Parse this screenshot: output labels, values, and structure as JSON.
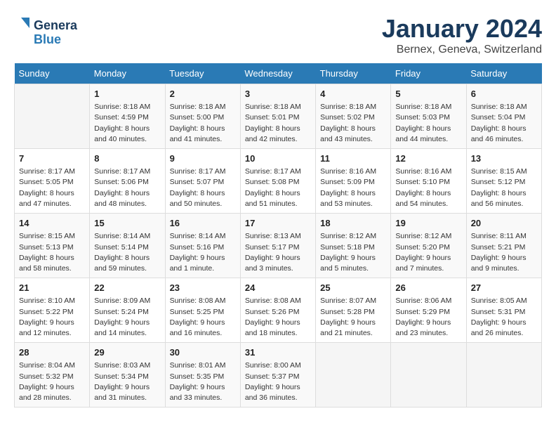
{
  "logo": {
    "line1": "General",
    "line2": "Blue"
  },
  "title": "January 2024",
  "subtitle": "Bernex, Geneva, Switzerland",
  "days_header": [
    "Sunday",
    "Monday",
    "Tuesday",
    "Wednesday",
    "Thursday",
    "Friday",
    "Saturday"
  ],
  "weeks": [
    [
      {
        "day": "",
        "info": ""
      },
      {
        "day": "1",
        "info": "Sunrise: 8:18 AM\nSunset: 4:59 PM\nDaylight: 8 hours\nand 40 minutes."
      },
      {
        "day": "2",
        "info": "Sunrise: 8:18 AM\nSunset: 5:00 PM\nDaylight: 8 hours\nand 41 minutes."
      },
      {
        "day": "3",
        "info": "Sunrise: 8:18 AM\nSunset: 5:01 PM\nDaylight: 8 hours\nand 42 minutes."
      },
      {
        "day": "4",
        "info": "Sunrise: 8:18 AM\nSunset: 5:02 PM\nDaylight: 8 hours\nand 43 minutes."
      },
      {
        "day": "5",
        "info": "Sunrise: 8:18 AM\nSunset: 5:03 PM\nDaylight: 8 hours\nand 44 minutes."
      },
      {
        "day": "6",
        "info": "Sunrise: 8:18 AM\nSunset: 5:04 PM\nDaylight: 8 hours\nand 46 minutes."
      }
    ],
    [
      {
        "day": "7",
        "info": "Sunrise: 8:17 AM\nSunset: 5:05 PM\nDaylight: 8 hours\nand 47 minutes."
      },
      {
        "day": "8",
        "info": "Sunrise: 8:17 AM\nSunset: 5:06 PM\nDaylight: 8 hours\nand 48 minutes."
      },
      {
        "day": "9",
        "info": "Sunrise: 8:17 AM\nSunset: 5:07 PM\nDaylight: 8 hours\nand 50 minutes."
      },
      {
        "day": "10",
        "info": "Sunrise: 8:17 AM\nSunset: 5:08 PM\nDaylight: 8 hours\nand 51 minutes."
      },
      {
        "day": "11",
        "info": "Sunrise: 8:16 AM\nSunset: 5:09 PM\nDaylight: 8 hours\nand 53 minutes."
      },
      {
        "day": "12",
        "info": "Sunrise: 8:16 AM\nSunset: 5:10 PM\nDaylight: 8 hours\nand 54 minutes."
      },
      {
        "day": "13",
        "info": "Sunrise: 8:15 AM\nSunset: 5:12 PM\nDaylight: 8 hours\nand 56 minutes."
      }
    ],
    [
      {
        "day": "14",
        "info": "Sunrise: 8:15 AM\nSunset: 5:13 PM\nDaylight: 8 hours\nand 58 minutes."
      },
      {
        "day": "15",
        "info": "Sunrise: 8:14 AM\nSunset: 5:14 PM\nDaylight: 8 hours\nand 59 minutes."
      },
      {
        "day": "16",
        "info": "Sunrise: 8:14 AM\nSunset: 5:16 PM\nDaylight: 9 hours\nand 1 minute."
      },
      {
        "day": "17",
        "info": "Sunrise: 8:13 AM\nSunset: 5:17 PM\nDaylight: 9 hours\nand 3 minutes."
      },
      {
        "day": "18",
        "info": "Sunrise: 8:12 AM\nSunset: 5:18 PM\nDaylight: 9 hours\nand 5 minutes."
      },
      {
        "day": "19",
        "info": "Sunrise: 8:12 AM\nSunset: 5:20 PM\nDaylight: 9 hours\nand 7 minutes."
      },
      {
        "day": "20",
        "info": "Sunrise: 8:11 AM\nSunset: 5:21 PM\nDaylight: 9 hours\nand 9 minutes."
      }
    ],
    [
      {
        "day": "21",
        "info": "Sunrise: 8:10 AM\nSunset: 5:22 PM\nDaylight: 9 hours\nand 12 minutes."
      },
      {
        "day": "22",
        "info": "Sunrise: 8:09 AM\nSunset: 5:24 PM\nDaylight: 9 hours\nand 14 minutes."
      },
      {
        "day": "23",
        "info": "Sunrise: 8:08 AM\nSunset: 5:25 PM\nDaylight: 9 hours\nand 16 minutes."
      },
      {
        "day": "24",
        "info": "Sunrise: 8:08 AM\nSunset: 5:26 PM\nDaylight: 9 hours\nand 18 minutes."
      },
      {
        "day": "25",
        "info": "Sunrise: 8:07 AM\nSunset: 5:28 PM\nDaylight: 9 hours\nand 21 minutes."
      },
      {
        "day": "26",
        "info": "Sunrise: 8:06 AM\nSunset: 5:29 PM\nDaylight: 9 hours\nand 23 minutes."
      },
      {
        "day": "27",
        "info": "Sunrise: 8:05 AM\nSunset: 5:31 PM\nDaylight: 9 hours\nand 26 minutes."
      }
    ],
    [
      {
        "day": "28",
        "info": "Sunrise: 8:04 AM\nSunset: 5:32 PM\nDaylight: 9 hours\nand 28 minutes."
      },
      {
        "day": "29",
        "info": "Sunrise: 8:03 AM\nSunset: 5:34 PM\nDaylight: 9 hours\nand 31 minutes."
      },
      {
        "day": "30",
        "info": "Sunrise: 8:01 AM\nSunset: 5:35 PM\nDaylight: 9 hours\nand 33 minutes."
      },
      {
        "day": "31",
        "info": "Sunrise: 8:00 AM\nSunset: 5:37 PM\nDaylight: 9 hours\nand 36 minutes."
      },
      {
        "day": "",
        "info": ""
      },
      {
        "day": "",
        "info": ""
      },
      {
        "day": "",
        "info": ""
      }
    ]
  ]
}
